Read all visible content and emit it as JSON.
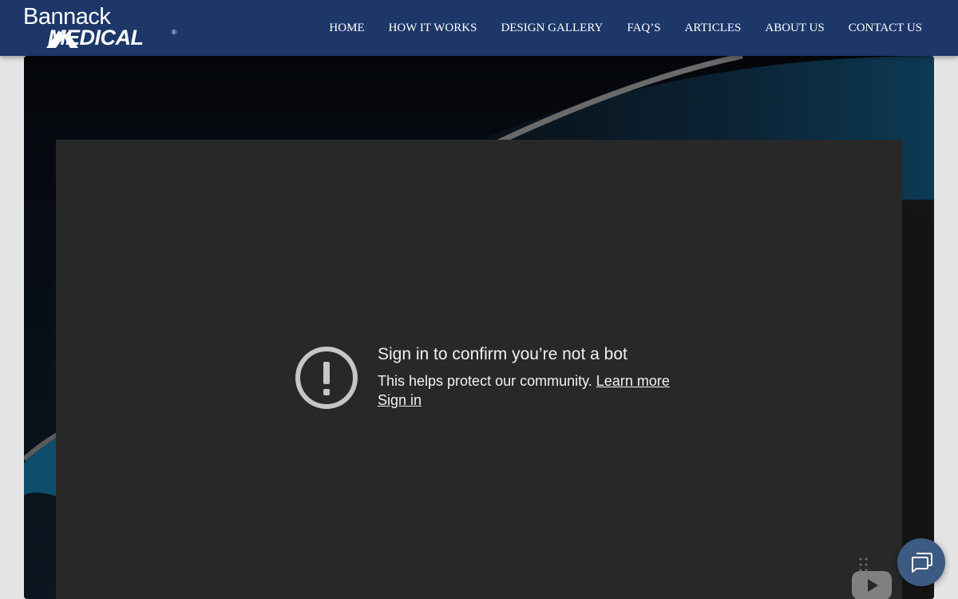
{
  "header": {
    "logo": {
      "line1": "Bannack",
      "line2": "MEDICAL",
      "registered": "®"
    },
    "nav": [
      {
        "label": "HOME"
      },
      {
        "label": "HOW IT WORKS"
      },
      {
        "label": "DESIGN GALLERY"
      },
      {
        "label": "FAQ’S"
      },
      {
        "label": "ARTICLES"
      },
      {
        "label": "ABOUT US"
      },
      {
        "label": "CONTACT US"
      }
    ]
  },
  "video": {
    "title": "Sign in to confirm you’re not a bot",
    "message": "This helps protect our community.",
    "learn_more": "Learn more",
    "sign_in": "Sign in",
    "alert_icon": "exclamation-circle-icon",
    "brand_icon": "youtube-play-icon"
  },
  "chat": {
    "icon": "chat-bubbles-icon"
  },
  "colors": {
    "header_bg": "#1c3768",
    "player_bg": "#282828",
    "accent_teal": "#0e5a7a",
    "chat_button": "#3c5a82"
  }
}
